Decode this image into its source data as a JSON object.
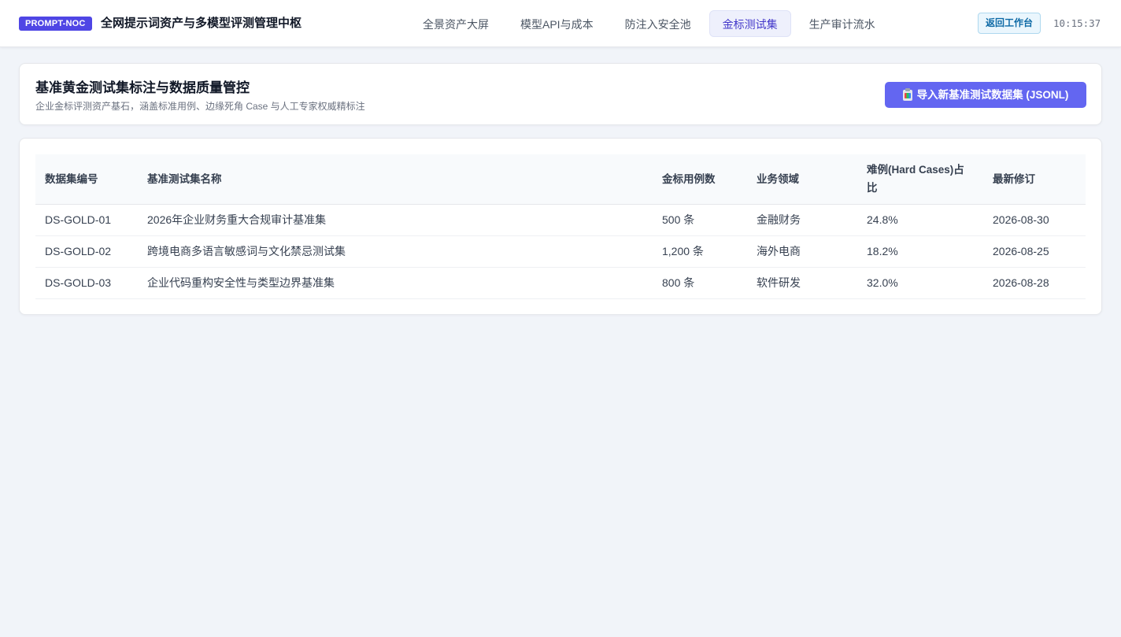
{
  "header": {
    "badge": "PROMPT-NOC",
    "title": "全网提示词资产与多模型评测管理中枢",
    "tabs": [
      {
        "label": "全景资产大屏",
        "active": false
      },
      {
        "label": "模型API与成本",
        "active": false
      },
      {
        "label": "防注入安全池",
        "active": false
      },
      {
        "label": "金标测试集",
        "active": true
      },
      {
        "label": "生产审计流水",
        "active": false
      }
    ],
    "back_label": "返回工作台",
    "time": "10:15:37"
  },
  "section": {
    "title": "基准黄金测试集标注与数据质量管控",
    "subtitle": "企业金标评测资产基石，涵盖标准用例、边缘死角 Case 与人工专家权威精标注",
    "import_label": "导入新基准测试数据集 (JSONL)",
    "import_icon": "clipboard-icon"
  },
  "table": {
    "columns": [
      "数据集编号",
      "基准测试集名称",
      "金标用例数",
      "业务领域",
      "难例(Hard Cases)占比",
      "最新修订"
    ],
    "rows": [
      [
        "DS-GOLD-01",
        "2026年企业财务重大合规审计基准集",
        "500 条",
        "金融财务",
        "24.8%",
        "2026-08-30"
      ],
      [
        "DS-GOLD-02",
        "跨境电商多语言敏感词与文化禁忌测试集",
        "1,200 条",
        "海外电商",
        "18.2%",
        "2026-08-25"
      ],
      [
        "DS-GOLD-03",
        "企业代码重构安全性与类型边界基准集",
        "800 条",
        "软件研发",
        "32.0%",
        "2026-08-28"
      ]
    ]
  },
  "colors": {
    "brand": "#4f46e5",
    "primary_button": "#6366f1",
    "active_tab_text": "#4338ca",
    "page_background": "#f1f4f9"
  }
}
